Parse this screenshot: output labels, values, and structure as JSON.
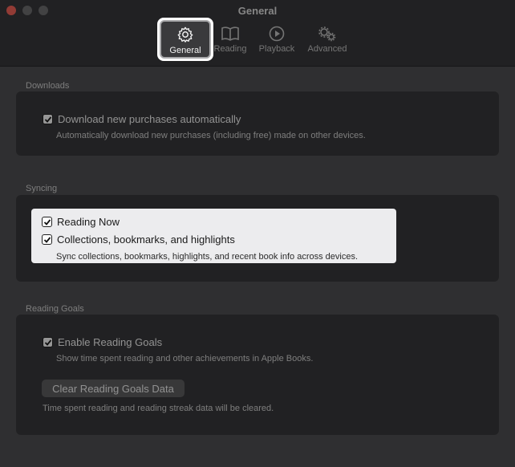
{
  "window": {
    "title": "General"
  },
  "tabs": [
    {
      "label": "General",
      "icon": "gear-icon"
    },
    {
      "label": "Reading",
      "icon": "book-icon"
    },
    {
      "label": "Playback",
      "icon": "play-circle-icon"
    },
    {
      "label": "Advanced",
      "icon": "gears-icon"
    }
  ],
  "downloads": {
    "title": "Downloads",
    "checkbox_label": "Download new purchases automatically",
    "description": "Automatically download new purchases (including free) made on other devices."
  },
  "syncing": {
    "title": "Syncing",
    "reading_now_label": "Reading Now",
    "collections_label": "Collections, bookmarks, and highlights",
    "description": "Sync collections, bookmarks, highlights, and recent book info across devices."
  },
  "reading_goals": {
    "title": "Reading Goals",
    "checkbox_label": "Enable Reading Goals",
    "description": "Show time spent reading and other achievements in Apple Books.",
    "clear_button": "Clear Reading Goals Data",
    "note": "Time spent reading and reading streak data will be cleared."
  },
  "colors": {
    "highlight": "#ffffff",
    "close": "#ec5f56"
  }
}
